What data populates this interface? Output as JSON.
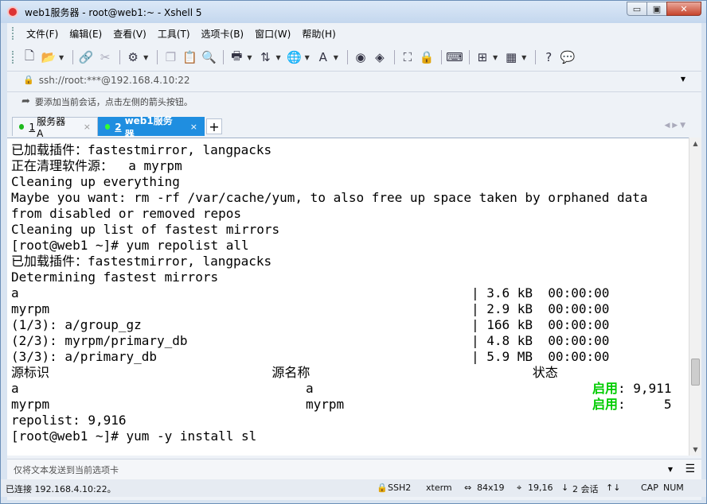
{
  "window": {
    "title": "web1服务器 - root@web1:~ - Xshell 5",
    "min_label": "▭",
    "max_label": "▣",
    "close_label": "✕"
  },
  "menu": [
    "文件(F)",
    "编辑(E)",
    "查看(V)",
    "工具(T)",
    "选项卡(B)",
    "窗口(W)",
    "帮助(H)"
  ],
  "address": {
    "value": "ssh://root:***@192.168.4.10:22"
  },
  "hint": {
    "text": "要添加当前会话，点击左侧的箭头按钮。"
  },
  "tabs": [
    {
      "num": "1",
      "label": "服务器A",
      "close": "×",
      "active": false
    },
    {
      "num": "2",
      "label": "web1服务器",
      "close": "×",
      "active": true
    }
  ],
  "add_tab": "+",
  "terminal": {
    "lines": [
      "已加载插件：fastestmirror, langpacks",
      "正在清理软件源：  a myrpm",
      "Cleaning up everything",
      "Maybe you want: rm -rf /var/cache/yum, to also free up space taken by orphaned data",
      "from disabled or removed repos",
      "Cleaning up list of fastest mirrors",
      "[root@web1 ~]# yum repolist all",
      "已加载插件：fastestmirror, langpacks",
      "Determining fastest mirrors",
      "a                                                           | 3.6 kB  00:00:00",
      "myrpm                                                       | 2.9 kB  00:00:00",
      "(1/3): a/group_gz                                           | 166 kB  00:00:00",
      "(2/3): myrpm/primary_db                                     | 4.8 kB  00:00:00",
      "(3/3): a/primary_db                                         | 5.9 MB  00:00:00",
      "源标识                             源名称                             状态"
    ],
    "repo_rows": [
      {
        "id": "a",
        "name": "a",
        "status": "启用",
        "count": ": 9,911"
      },
      {
        "id": "myrpm",
        "name": "myrpm",
        "status": "启用",
        "count": ":     5"
      }
    ],
    "tail": [
      "repolist: 9,916",
      "[root@web1 ~]# yum -y install sl"
    ]
  },
  "send_bar": {
    "placeholder": "仅将文本发送到当前选项卡"
  },
  "status": {
    "connection": "已连接 192.168.4.10:22。",
    "protocol": "SSH2",
    "term": "xterm",
    "size": "84x19",
    "cursor": "19,16",
    "sessions": "2 会话",
    "caps": "CAP",
    "num": "NUM"
  },
  "colors": {
    "active_tab": "#1f8ee0",
    "enabled_green": "#00cc00",
    "online_dot": "#1db91d"
  }
}
